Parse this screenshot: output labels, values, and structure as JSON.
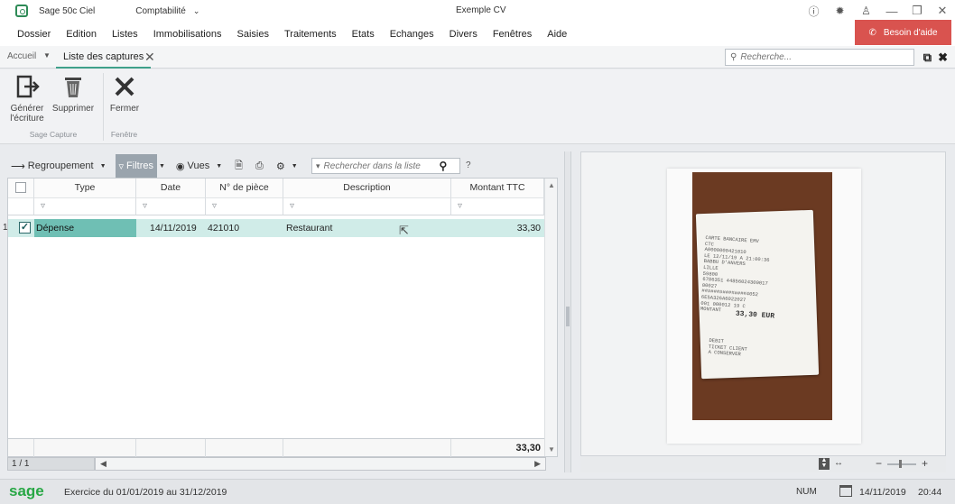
{
  "app": {
    "name": "Sage 50c Ciel",
    "module": "Comptabilité",
    "document_title": "Exemple CV",
    "help_label": "Besoin d'aide"
  },
  "menu": [
    "Dossier",
    "Edition",
    "Listes",
    "Immobilisations",
    "Saisies",
    "Traitements",
    "Etats",
    "Echanges",
    "Divers",
    "Fenêtres",
    "Aide"
  ],
  "tabs": {
    "home": "Accueil",
    "active": "Liste des captures",
    "search_placeholder": "Recherche..."
  },
  "ribbon": {
    "generate_label_line1": "Générer",
    "generate_label_line2": "l'écriture",
    "delete_label": "Supprimer",
    "close_label": "Fermer",
    "group1_label": "Sage Capture",
    "group2_label": "Fenêtre"
  },
  "list_toolbar": {
    "grouping": "Regroupement",
    "filters": "Filtres",
    "views": "Vues",
    "search_placeholder": "Rechercher dans la liste",
    "help": "?"
  },
  "grid": {
    "headers": [
      "Type",
      "Date",
      "N° de pièce",
      "Description",
      "Montant TTC"
    ],
    "rows": [
      {
        "num": "1",
        "type": "Dépense",
        "date": "14/11/2019",
        "piece": "421010",
        "description": "Restaurant",
        "amount": "33,30"
      }
    ],
    "total": "33,30",
    "pager": "1 / 1"
  },
  "receipt": {
    "lines": "CARTE BANCAIRE EMV\nCTC\nA0000000421010\nLE 12/11/19 A 21:00:36\nBABBU D'ANVERS\nLILLE\n59800\n6786351 44856024300017\n00027\n###############4052\n6E5A326A6022027\n001 000012 19 C\nMONTANT",
    "amount": "33,30 EUR",
    "footer": "DEBIT\nTICKET CLIENT\nA CONSERVER"
  },
  "status": {
    "brand": "sage",
    "exercise": "Exercice du 01/01/2019 au 31/12/2019",
    "num": "NUM",
    "date": "14/11/2019",
    "time": "20:44"
  },
  "colors": {
    "accent": "#3fa08a",
    "selected_row": "#d0ece8",
    "selected_cell": "#6fbfb4",
    "help_button": "#d9534f",
    "brand": "#28a745"
  }
}
